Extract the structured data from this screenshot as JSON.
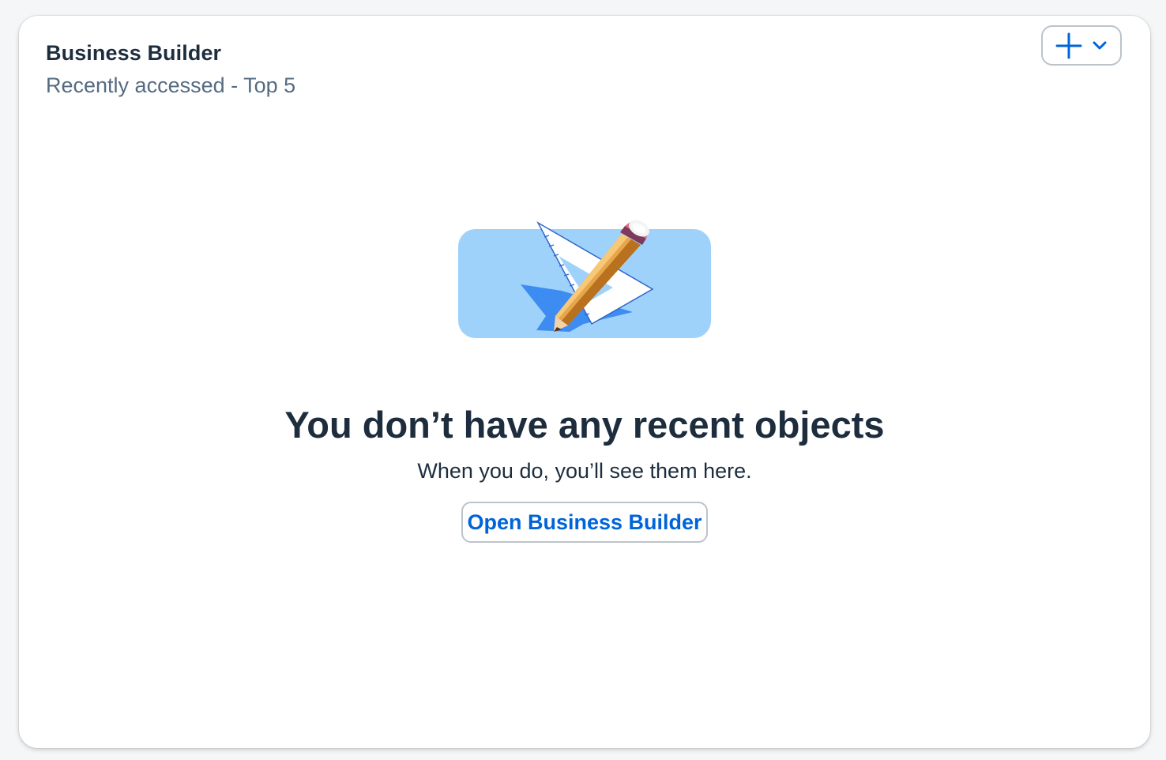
{
  "card": {
    "title": "Business Builder",
    "subtitle": "Recently accessed - Top 5",
    "add_menu": {
      "icons": [
        "plus-icon",
        "chevron-down-icon"
      ]
    }
  },
  "empty_state": {
    "illustration": "pencil-and-ruler-illustration",
    "title": "You don’t have any recent objects",
    "description": "When you do, you’ll see them here.",
    "button_label": "Open Business Builder"
  },
  "colors": {
    "accent": "#0064d9",
    "text_primary": "#1d2d3e",
    "text_secondary": "#556b82",
    "illustration_bg": "#9fd2fb"
  }
}
